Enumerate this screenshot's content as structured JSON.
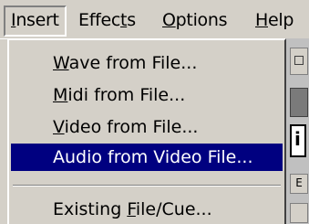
{
  "menubar": {
    "items": [
      {
        "label": "Insert",
        "mnemonic_index": 0
      },
      {
        "label": "Effects",
        "mnemonic_index": 5
      },
      {
        "label": "Options",
        "mnemonic_index": 0
      },
      {
        "label": "Help",
        "mnemonic_index": 0
      }
    ]
  },
  "insert_menu": {
    "items": [
      {
        "label": "Wave from File...",
        "mnemonic_index": 0
      },
      {
        "label": "Midi from File...",
        "mnemonic_index": 0
      },
      {
        "label": "Video from File...",
        "mnemonic_index": 0
      },
      {
        "label": "Audio from Video File...",
        "highlighted": true
      },
      {
        "label": "Existing File/Cue...",
        "mnemonic_index": 9
      }
    ]
  },
  "background": {
    "toolbar_letter": "i",
    "toolbar_letter_2": "E"
  },
  "colors": {
    "menu_bg": "#d4d0c8",
    "highlight": "#000080",
    "highlight_text": "#ffffff"
  }
}
